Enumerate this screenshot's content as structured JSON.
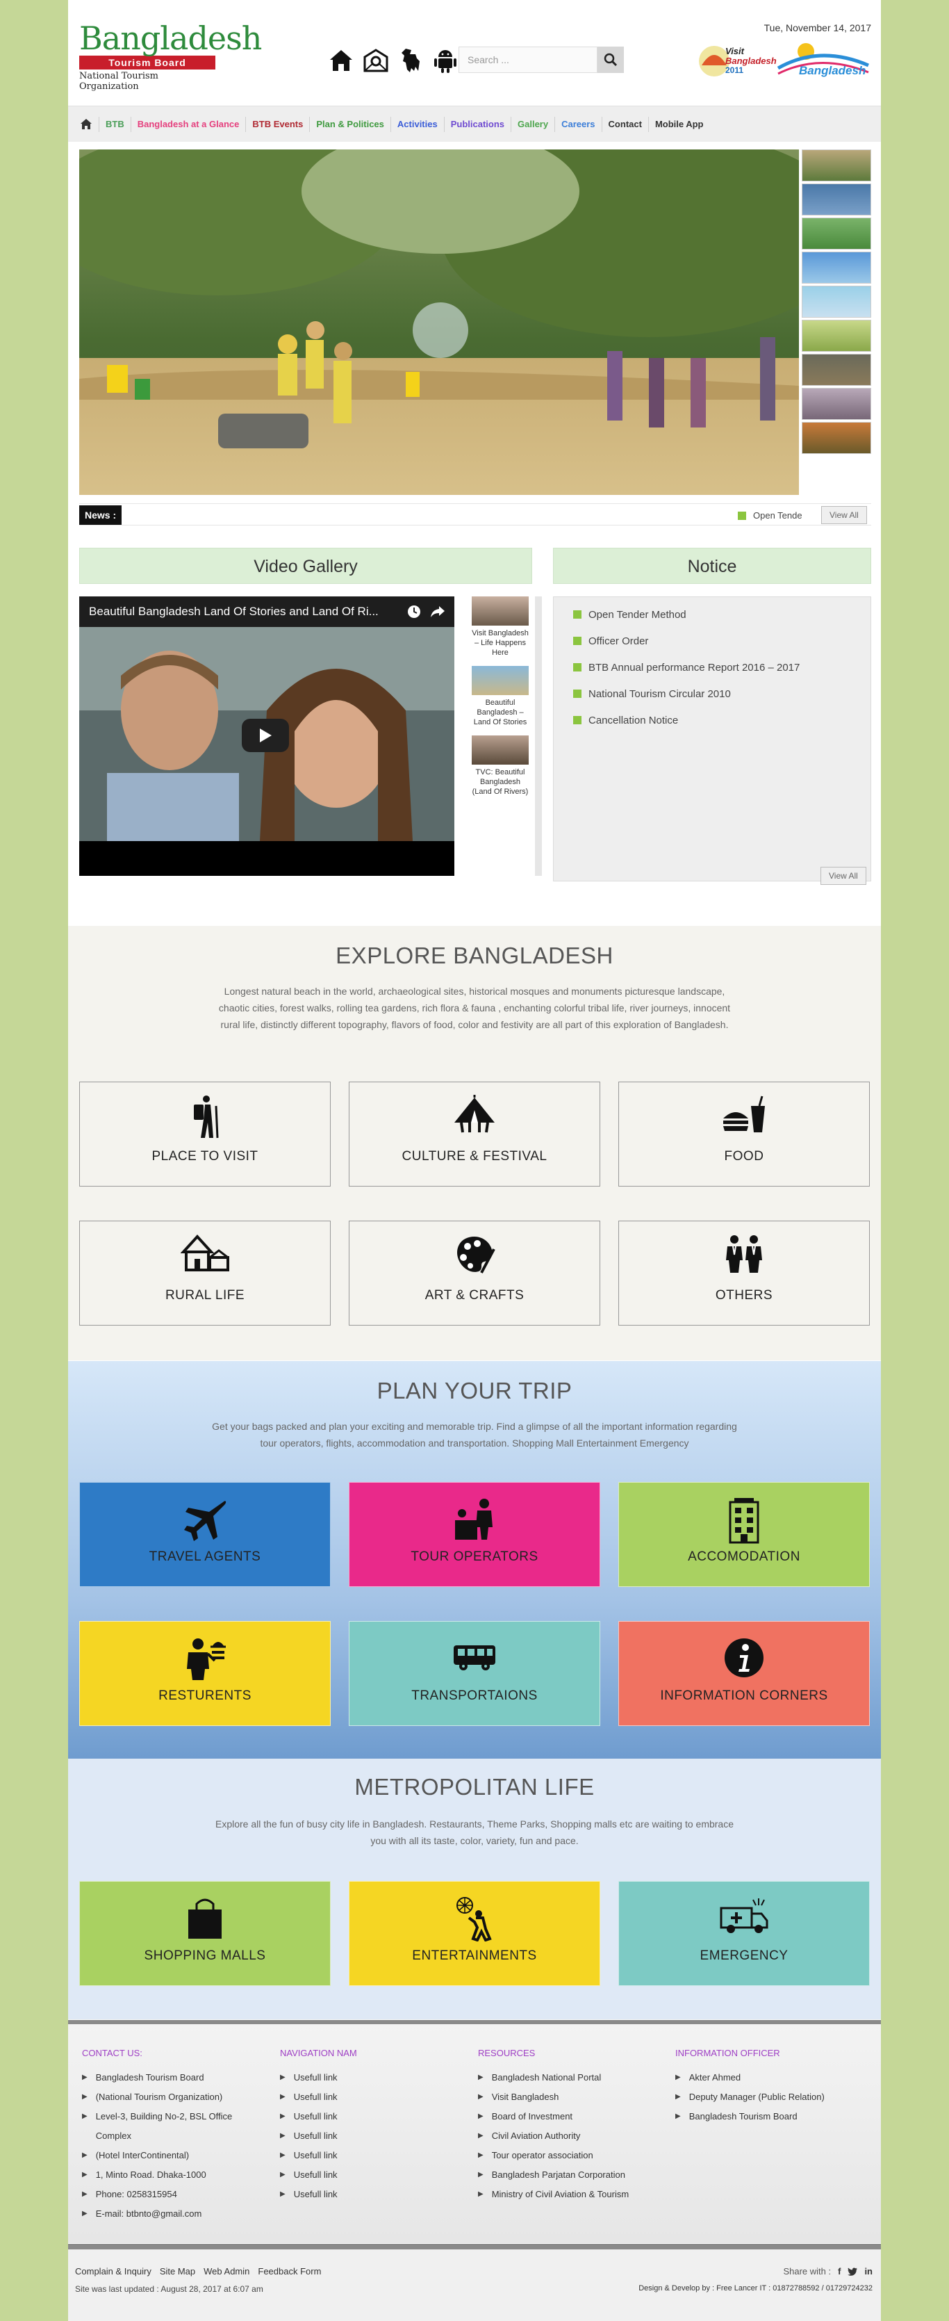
{
  "header": {
    "logo": {
      "word": "Bangladesh",
      "board": "Tourism Board",
      "org": "National Tourism Organization"
    },
    "search_placeholder": "Search ...",
    "date": "Tue, November 14, 2017",
    "campaign": {
      "line1": "Visit",
      "line2": "Bangladesh",
      "year": "2011"
    }
  },
  "nav": {
    "items": [
      {
        "label": "BTB",
        "color": "#4a9e58"
      },
      {
        "label": "Bangladesh at a Glance",
        "color": "#e5407e"
      },
      {
        "label": "BTB Events",
        "color": "#b02a33"
      },
      {
        "label": "Plan & Politices",
        "color": "#3f9a3f"
      },
      {
        "label": "Activities",
        "color": "#3c5ed8"
      },
      {
        "label": "Publications",
        "color": "#6f4bd1"
      },
      {
        "label": "Gallery",
        "color": "#4ea64e"
      },
      {
        "label": "Careers",
        "color": "#3c7ed8"
      },
      {
        "label": "Contact",
        "color": "#333333"
      },
      {
        "label": "Mobile App",
        "color": "#333333"
      }
    ]
  },
  "news": {
    "label": "News :",
    "ticker": "Open Tende",
    "view_all": "View All"
  },
  "video": {
    "heading": "Video Gallery",
    "title": "Beautiful Bangladesh Land Of Stories and Land Of Ri...",
    "list": [
      "Visit Bangladesh – Life Happens Here",
      "Beautiful Bangladesh – Land Of Stories",
      "TVC: Beautiful Bangladesh (Land Of Rivers)"
    ]
  },
  "notice": {
    "heading": "Notice",
    "items": [
      "Open Tender Method",
      "Officer Order",
      "BTB Annual performance Report 2016 – 2017",
      "National Tourism Circular 2010",
      "Cancellation Notice"
    ],
    "view_all": "View All"
  },
  "explore": {
    "title": "EXPLORE BANGLADESH",
    "desc": "Longest natural beach in the world, archaeological sites, historical mosques and monuments picturesque landscape, chaotic cities, forest walks, rolling tea gardens, rich flora & fauna , enchanting colorful tribal life, river journeys, innocent rural life, distinctly different topography, flavors of food, color and festivity are all part of this exploration of Bangladesh.",
    "cards": [
      "PLACE TO VISIT",
      "CULTURE & FESTIVAL",
      "FOOD",
      "RURAL LIFE",
      "ART & CRAFTS",
      "OTHERS"
    ]
  },
  "plan": {
    "title": "PLAN YOUR TRIP",
    "desc": "Get your bags packed and plan your exciting and memorable trip. Find a glimpse of all the important information regarding tour operators, flights, accommodation and transportation. Shopping Mall Entertainment Emergency",
    "cards": [
      {
        "label": "TRAVEL AGENTS",
        "color": "#2e7bc6"
      },
      {
        "label": "TOUR OPERATORS",
        "color": "#e9298a"
      },
      {
        "label": "ACCOMODATION",
        "color": "#a9d161"
      },
      {
        "label": "RESTURENTS",
        "color": "#f5d623"
      },
      {
        "label": "TRANSPORTAIONS",
        "color": "#7dcac4"
      },
      {
        "label": "INFORMATION CORNERS",
        "color": "#f07261"
      }
    ]
  },
  "metro": {
    "title": "METROPOLITAN LIFE",
    "desc": "Explore all the fun of busy city life in Bangladesh. Restaurants, Theme Parks, Shopping malls etc are waiting to embrace you with all its taste, color, variety, fun and pace.",
    "cards": [
      {
        "label": "SHOPPING MALLS",
        "color": "#a9d161"
      },
      {
        "label": "ENTERTAINMENTS",
        "color": "#f5d623"
      },
      {
        "label": "EMERGENCY",
        "color": "#7dcac4"
      }
    ]
  },
  "footer": {
    "contact": {
      "title": "CONTACT US:",
      "lines": [
        "Bangladesh Tourism Board",
        "(National Tourism Organization)",
        "Level-3, Building No-2, BSL Office Complex",
        "(Hotel InterContinental)",
        "1, Minto Road. Dhaka-1000",
        "Phone: 0258315954",
        "E-mail: btbnto@gmail.com"
      ]
    },
    "navigation": {
      "title": "NAVIGATION NAM",
      "lines": [
        "Usefull link",
        "Usefull link",
        "Usefull link",
        "Usefull link",
        "Usefull link",
        "Usefull link",
        "Usefull link"
      ]
    },
    "resources": {
      "title": "RESOURCES",
      "lines": [
        "Bangladesh National Portal",
        "Visit Bangladesh",
        "Board of Investment",
        "Civil Aviation Authority",
        "Tour operator association",
        "Bangladesh Parjatan Corporation",
        "Ministry of Civil Aviation & Tourism"
      ]
    },
    "officer": {
      "title": "INFORMATION OFFICER",
      "lines": [
        "Akter Ahmed",
        "Deputy Manager (Public Relation)",
        "Bangladesh Tourism Board"
      ]
    }
  },
  "bottom": {
    "links": [
      "Complain & Inquiry",
      "Site Map",
      "Web Admin",
      "Feedback Form"
    ],
    "updated": "Site was last updated : August 28, 2017 at 6:07 am",
    "share_label": "Share with :",
    "dev": "Design & Develop by : Free Lancer IT : 01872788592 / 01729724232"
  }
}
